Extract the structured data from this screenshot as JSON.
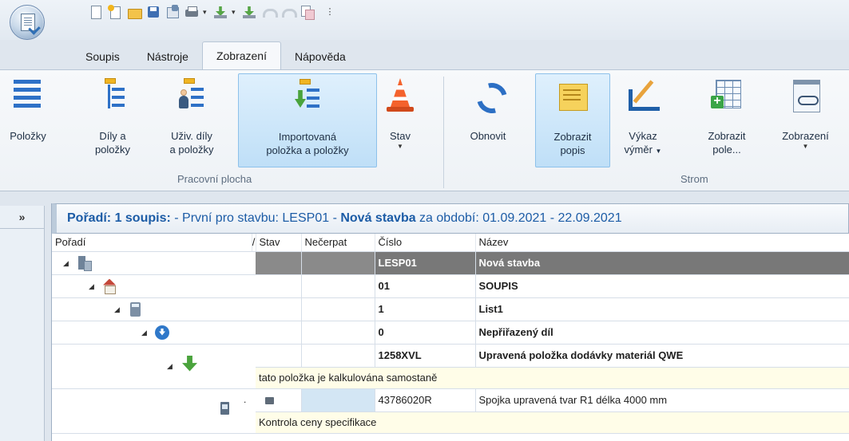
{
  "qat": {
    "more": "⋮"
  },
  "tabs": [
    {
      "label": "Soupis"
    },
    {
      "label": "Nástroje"
    },
    {
      "label": "Zobrazení"
    },
    {
      "label": "Nápověda"
    }
  ],
  "ribbon": {
    "pracovni": {
      "label": "Pracovní plocha",
      "polozky": "Položky",
      "dily_1": "Díly a",
      "dily_2": "položky",
      "uziv_1": "Uživ. díly",
      "uziv_2": "a položky",
      "imp_1": "Importovaná",
      "imp_2": "položka a položky",
      "stav": "Stav",
      "arrow": "▼"
    },
    "strom": {
      "label": "Strom",
      "obnovit": "Obnovit",
      "zobrazit_1": "Zobrazit",
      "zobrazit_2": "popis",
      "vykaz_1": "Výkaz",
      "vykaz_2": "výměr",
      "zpole_1": "Zobrazit",
      "zpole_2": "pole...",
      "zobrazeni": "Zobrazení"
    }
  },
  "sidebar": {
    "expand": "»"
  },
  "panel": {
    "title_bold": "Pořadí: 1 soupis:",
    "title_rest": " - První pro stavbu: LESP01 - ",
    "title_bold2": "Nová stavba",
    "title_rest2": " za období: 01.09.2021 - 22.09.2021"
  },
  "table": {
    "headers": {
      "poradi": "Pořadí",
      "sort": "/",
      "stav": "Stav",
      "necerpat": "Nečerpat",
      "cislo": "Číslo",
      "nazev": "Název"
    },
    "rows": [
      {
        "cislo": "LESP01",
        "nazev": "Nová stavba"
      },
      {
        "cislo": "01",
        "nazev": "SOUPIS"
      },
      {
        "cislo": "1",
        "nazev": "List1"
      },
      {
        "cislo": "0",
        "nazev": "Nepřiřazený díl"
      },
      {
        "cislo": "1258XVL",
        "nazev": "Upravená položka dodávky materiál QWE"
      },
      {
        "note": "tato položka je kalkulována samostaně"
      },
      {
        "dot": ".",
        "cislo": "43786020R",
        "nazev": "Spojka upravená tvar R1 délka 4000 mm"
      },
      {
        "note": "Kontrola ceny specifikace"
      }
    ]
  }
}
